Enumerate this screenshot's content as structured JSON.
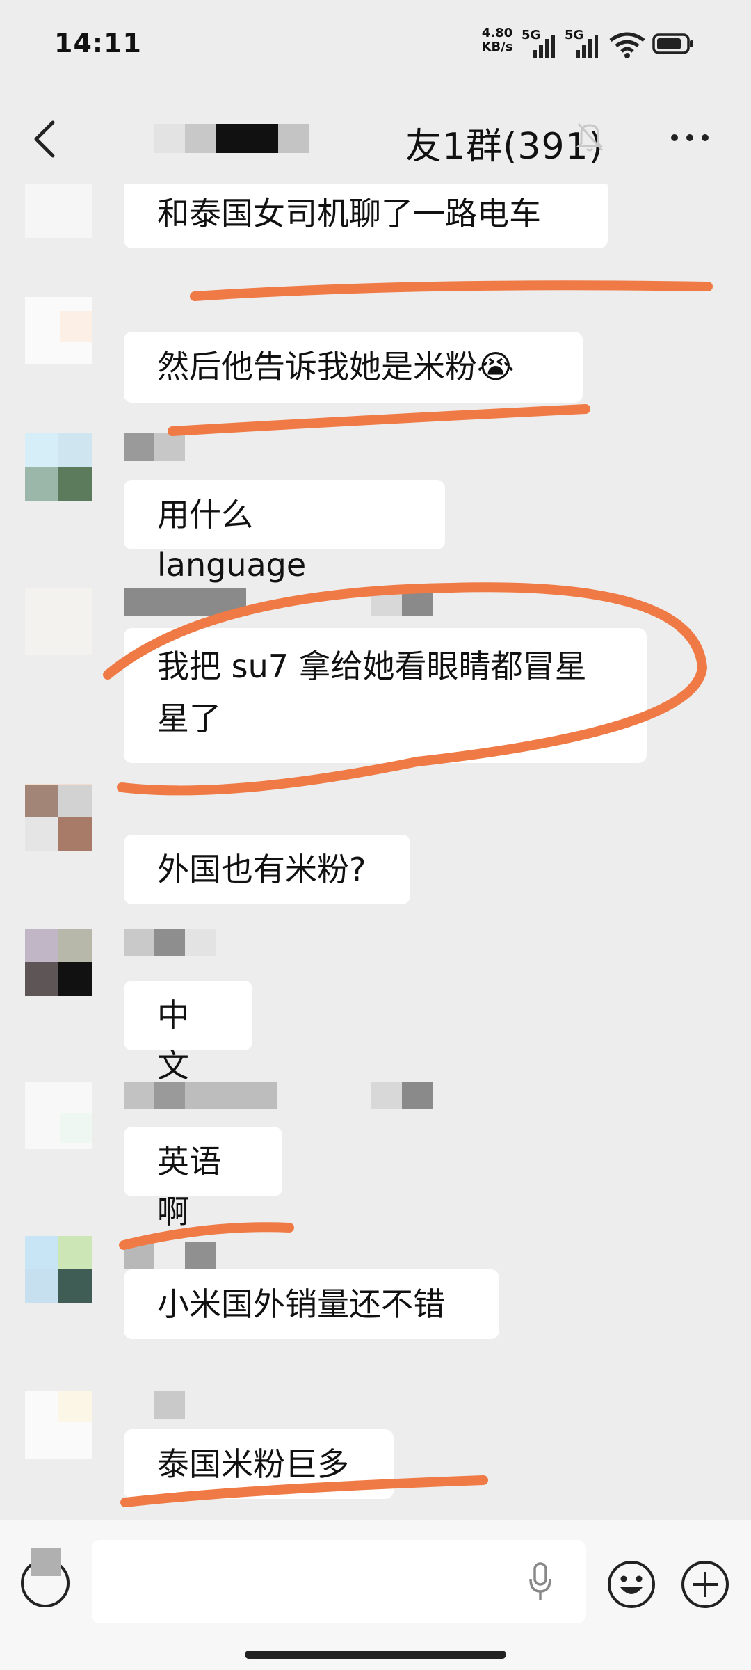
{
  "status_bar": {
    "time": "14:11",
    "net_speed_value": "4.80",
    "net_speed_unit": "KB/s",
    "signal_1": "5G",
    "signal_2": "5G",
    "wifi_label": "7"
  },
  "header": {
    "title": "友1群(391)",
    "back_icon": "chevron-left-icon",
    "mute_icon": "bell-muted-icon",
    "more_icon": "more-dots-icon"
  },
  "messages": [
    {
      "text": "和泰国女司机聊了一路电车"
    },
    {
      "text": "然后他告诉我她是米粉",
      "emoji": "😭"
    },
    {
      "text": "用什么 language"
    },
    {
      "text": "我把 su7 拿给她看眼睛都冒星",
      "text2": "星了"
    },
    {
      "text": "外国也有米粉?"
    },
    {
      "text": "中文"
    },
    {
      "text": "英语啊"
    },
    {
      "text": "小米国外销量还不错"
    },
    {
      "text": "泰国米粉巨多"
    }
  ],
  "input_bar": {
    "voice_icon": "voice-icon",
    "mic_icon": "mic-icon",
    "emoji_icon": "emoji-icon",
    "plus_icon": "plus-icon"
  },
  "colors": {
    "background": "#ededed",
    "bubble": "#ffffff",
    "annotation": "#f07a45"
  }
}
